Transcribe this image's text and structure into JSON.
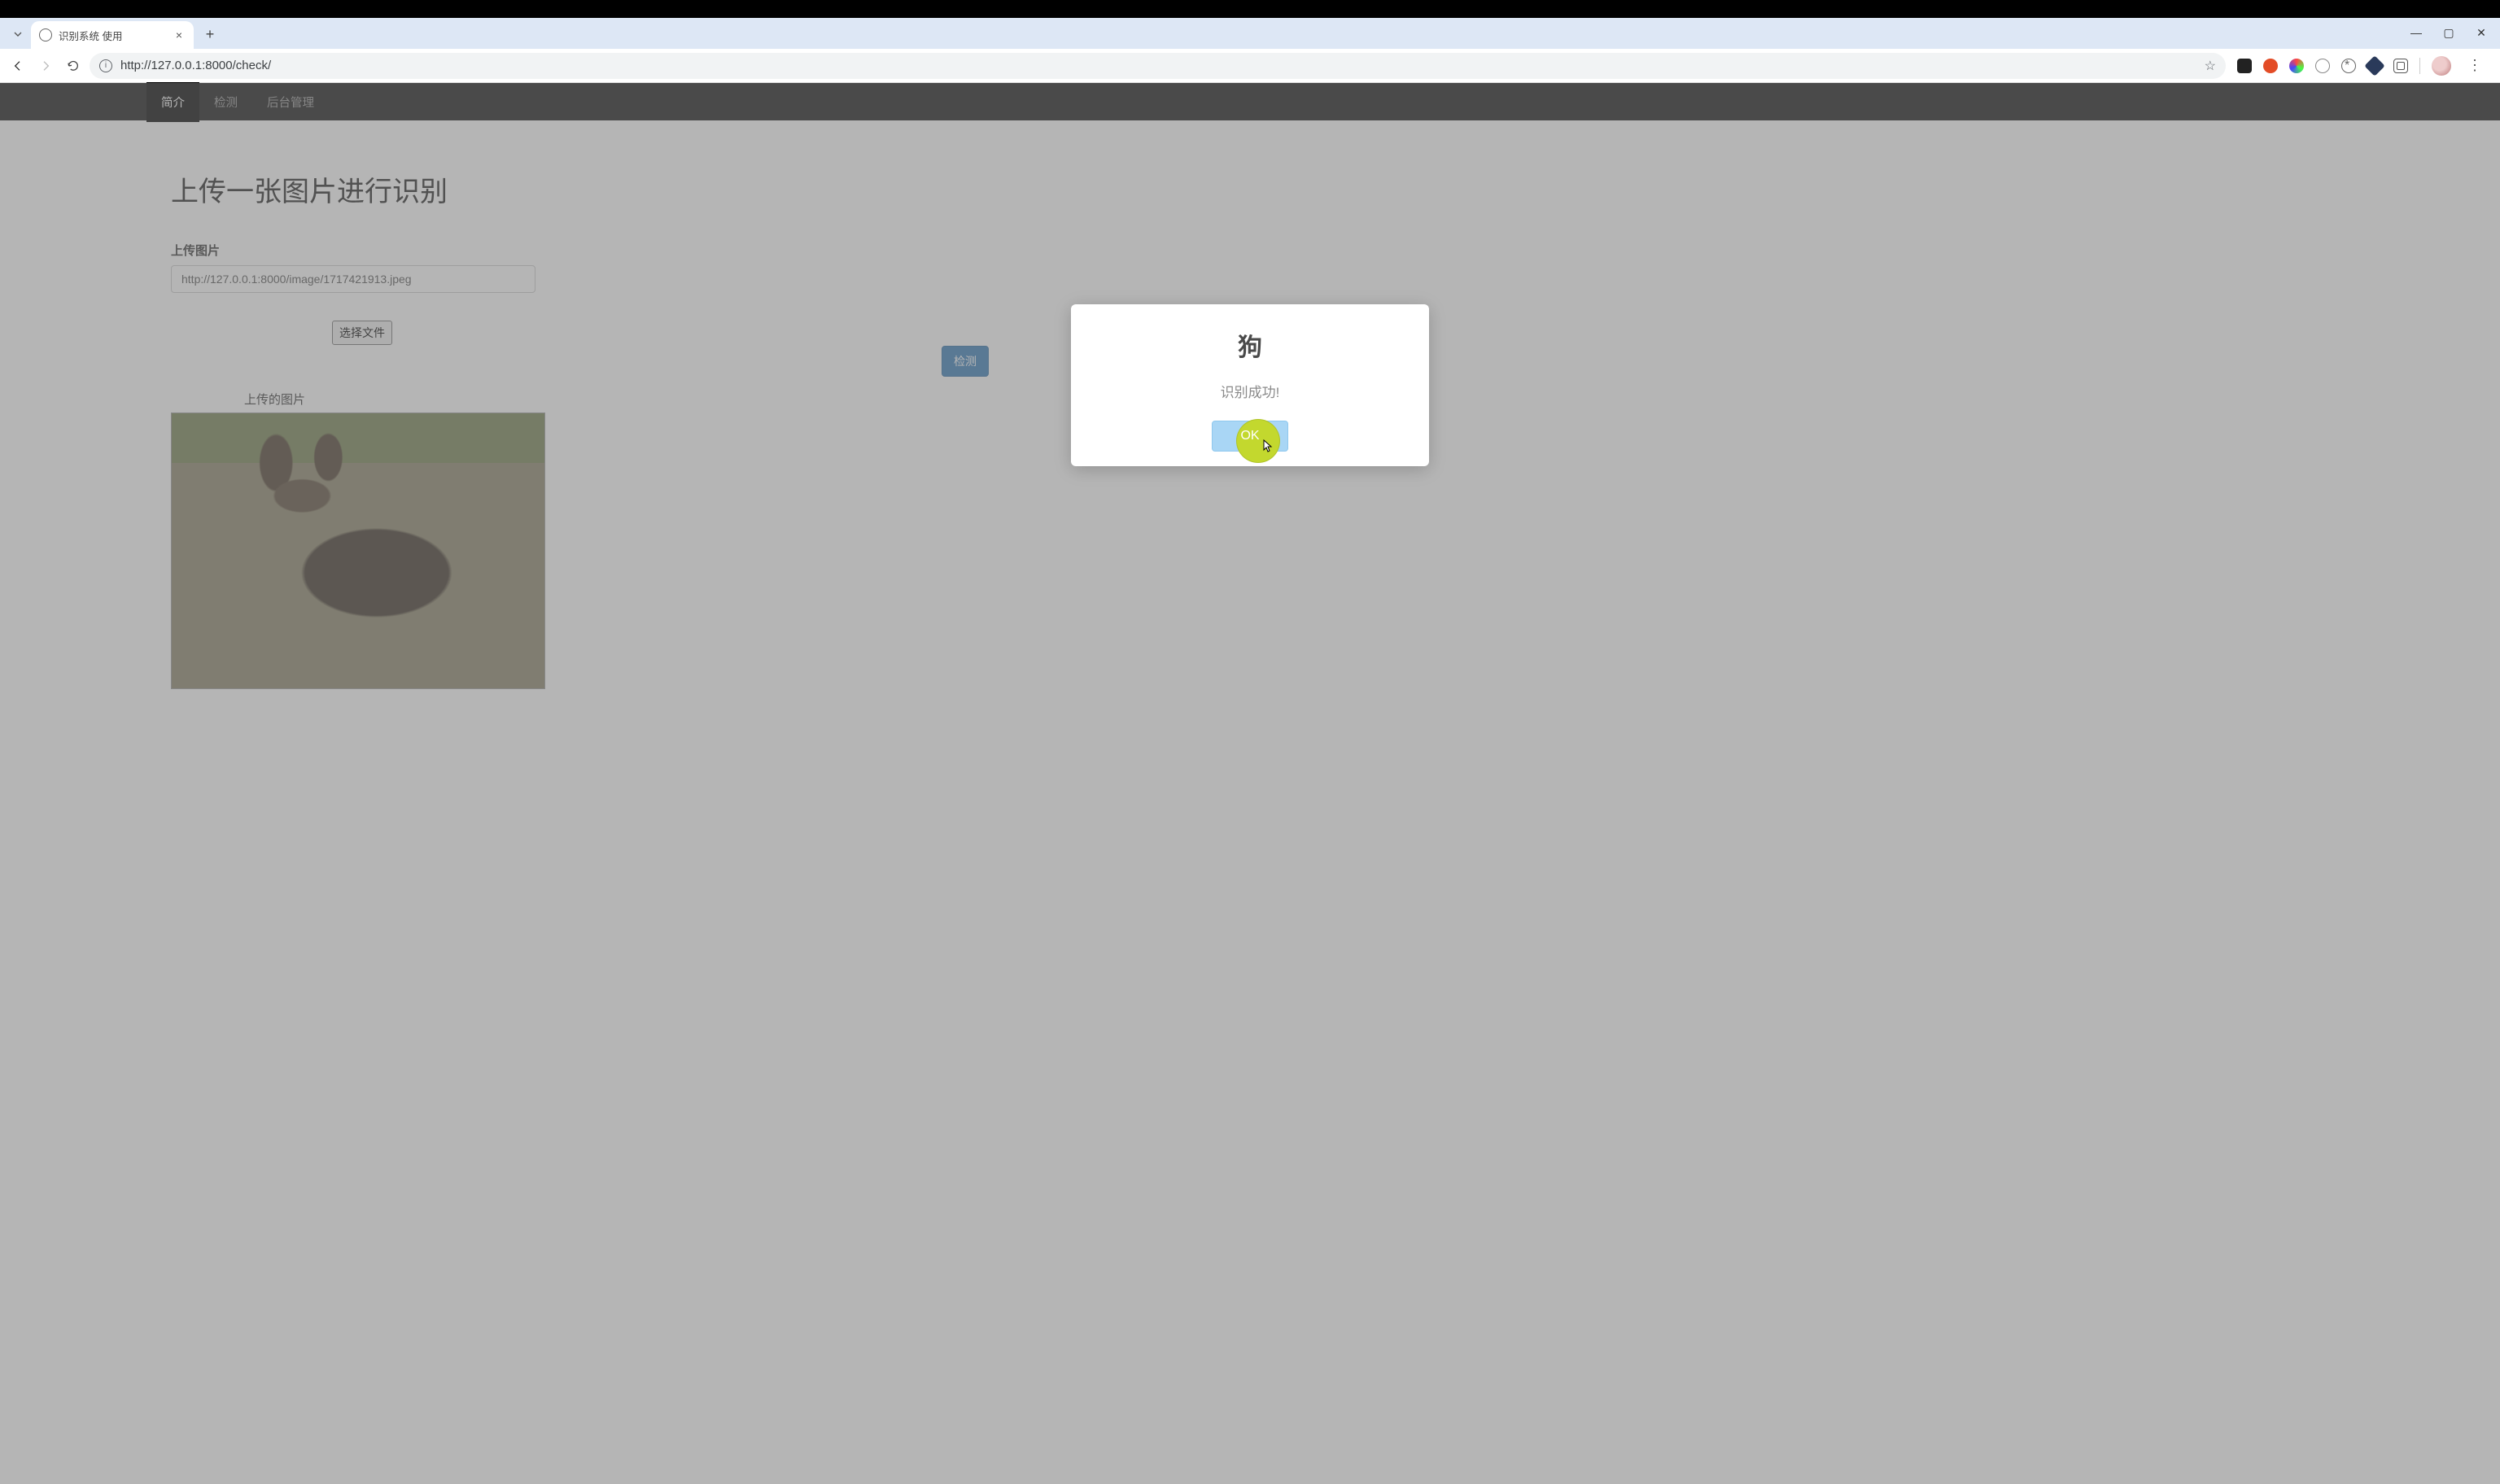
{
  "browser": {
    "tab_title": "识别系统 使用",
    "url": "http://127.0.0.1:8000/check/"
  },
  "navbar": {
    "items": [
      "简介",
      "检测",
      "后台管理"
    ],
    "active_index": 0
  },
  "page": {
    "title": "上传一张图片进行识别",
    "upload_label": "上传图片",
    "input_value": "http://127.0.0.1:8000/image/1717421913.jpeg",
    "choose_file_label": "选择文件",
    "detect_label": "检测",
    "uploaded_caption": "上传的图片"
  },
  "modal": {
    "title": "狗",
    "message": "识别成功!",
    "ok_label": "OK"
  }
}
